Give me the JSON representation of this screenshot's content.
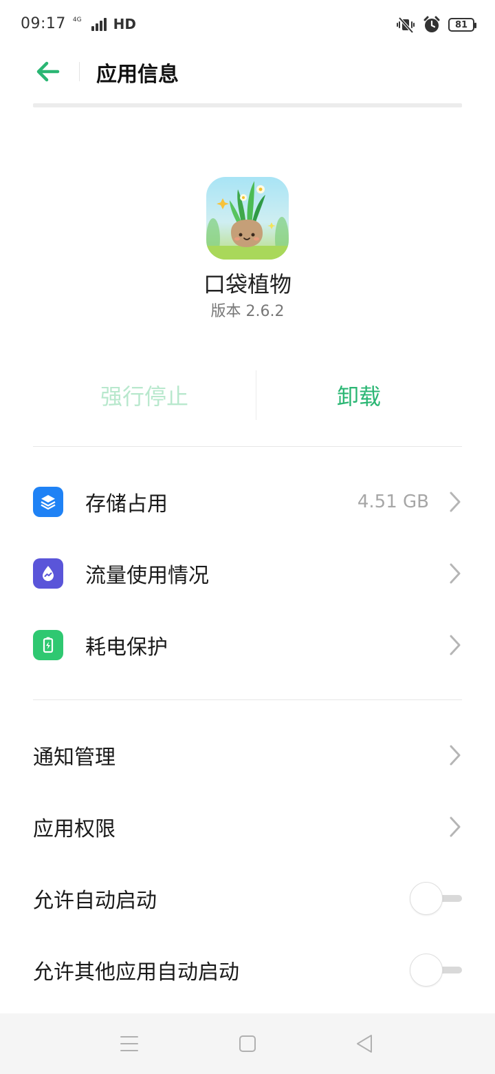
{
  "status_bar": {
    "time": "09:17",
    "network": "4G",
    "hd": "HD",
    "battery": "81"
  },
  "header": {
    "title": "应用信息"
  },
  "app": {
    "name": "口袋植物",
    "version": "版本 2.6.2"
  },
  "actions": {
    "force_stop": "强行停止",
    "uninstall": "卸载"
  },
  "usage_items": [
    {
      "label": "存储占用",
      "value": "4.51 GB",
      "icon": "layers-icon",
      "color": "#1f82f5"
    },
    {
      "label": "流量使用情况",
      "value": "",
      "icon": "data-drop-icon",
      "color": "#5a55d9"
    },
    {
      "label": "耗电保护",
      "value": "",
      "icon": "battery-charging-icon",
      "color": "#2fc871"
    }
  ],
  "settings_items": [
    {
      "label": "通知管理"
    },
    {
      "label": "应用权限"
    }
  ],
  "toggles": [
    {
      "label": "允许自动启动",
      "on": false
    },
    {
      "label": "允许其他应用自动启动",
      "on": false
    }
  ],
  "colors": {
    "accent": "#2ab673",
    "accent_disabled": "#b8e8cd"
  }
}
